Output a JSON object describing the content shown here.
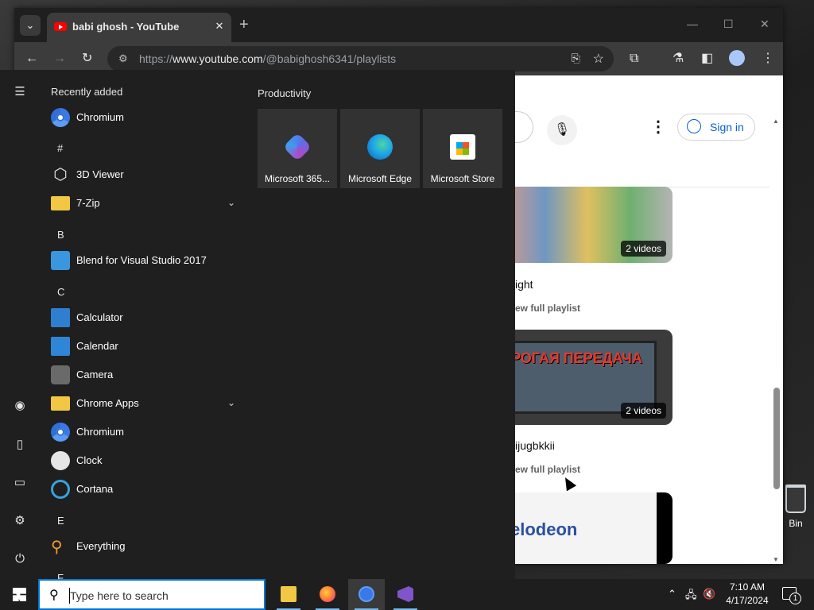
{
  "browser": {
    "tab_title": "babi ghosh - YouTube",
    "url_prefix": "https://",
    "url_host": "www.youtube.com",
    "url_path": "/@babighosh6341/playlists",
    "new_tab": "+",
    "close_tab": "✕",
    "minimize": "—",
    "maximize": "☐",
    "close_window": "✕"
  },
  "youtube": {
    "sign_in": "Sign in",
    "playlists": [
      {
        "title": "ight",
        "badge": "2 videos",
        "link": "ew full playlist"
      },
      {
        "title": "ijugbkkii",
        "badge": "2 videos",
        "link": "ew full playlist",
        "thumb_text": "ДОРОГАЯ ПЕРЕДАЧА"
      },
      {
        "thumb_text": "nickelodeon"
      }
    ]
  },
  "start_menu": {
    "recently_added_header": "Recently added",
    "tiles_header": "Productivity",
    "recent": [
      {
        "name": "Chromium",
        "icon": "chromium-icon"
      }
    ],
    "groups": [
      {
        "letter": "#",
        "apps": [
          {
            "name": "3D Viewer",
            "icon": "cube-icon"
          },
          {
            "name": "7-Zip",
            "icon": "folder-icon",
            "expandable": true
          }
        ]
      },
      {
        "letter": "B",
        "apps": [
          {
            "name": "Blend for Visual Studio 2017",
            "icon": "blend-icon"
          }
        ]
      },
      {
        "letter": "C",
        "apps": [
          {
            "name": "Calculator",
            "icon": "calculator-icon"
          },
          {
            "name": "Calendar",
            "icon": "calendar-icon"
          },
          {
            "name": "Camera",
            "icon": "camera-icon"
          },
          {
            "name": "Chrome Apps",
            "icon": "folder-icon",
            "expandable": true
          },
          {
            "name": "Chromium",
            "icon": "chromium-icon"
          },
          {
            "name": "Clock",
            "icon": "clock-icon"
          },
          {
            "name": "Cortana",
            "icon": "cortana-icon"
          }
        ]
      },
      {
        "letter": "E",
        "apps": [
          {
            "name": "Everything",
            "icon": "search-icon"
          }
        ]
      },
      {
        "letter": "F",
        "apps": []
      }
    ],
    "tiles": [
      {
        "name": "Microsoft 365...",
        "icon": "microsoft-365-icon"
      },
      {
        "name": "Microsoft Edge",
        "icon": "edge-icon"
      },
      {
        "name": "Microsoft Store",
        "icon": "store-icon"
      }
    ]
  },
  "taskbar": {
    "search_placeholder": "Type here to search",
    "time": "7:10 AM",
    "date": "4/17/2024",
    "notification_count": "1"
  },
  "desktop": {
    "recycle_bin_label": "Bin"
  },
  "colors": {
    "taskbar_accent": "#0078d7",
    "youtube_red": "#ff0000",
    "signin_blue": "#065fd4"
  }
}
